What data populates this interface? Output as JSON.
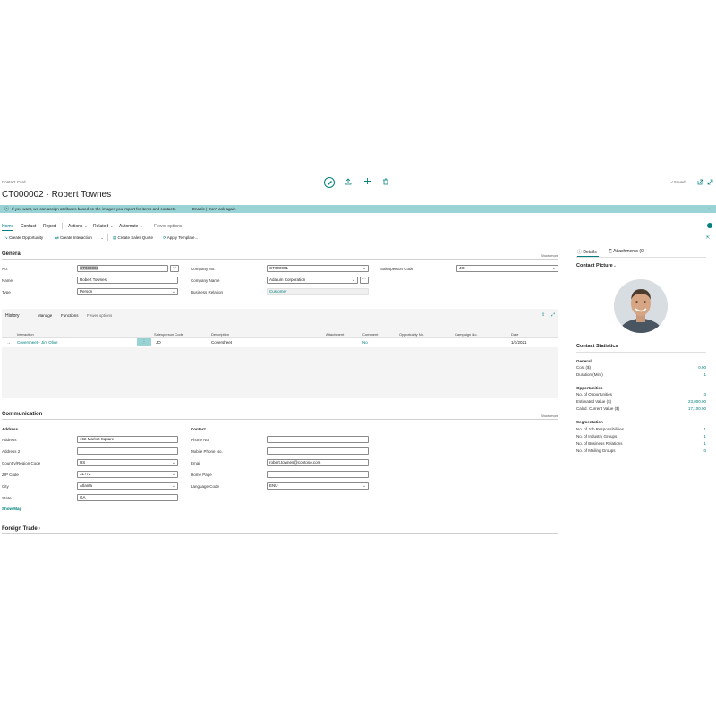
{
  "header": {
    "breadcrumb": "Contact Card",
    "title": "CT000002 · Robert Townes",
    "saved": "Saved"
  },
  "banner": {
    "text": "If you want, we can assign attributes based on the images you import for items and contacts.",
    "actions": "Enable | Don't ask again"
  },
  "menu": {
    "home": "Home",
    "contact": "Contact",
    "report": "Report",
    "actions": "Actions",
    "related": "Related",
    "automate": "Automate",
    "fewer": "Fewer options"
  },
  "actionbar": {
    "create_opportunity": "Create Opportunity",
    "create_interaction": "Create Interaction",
    "create_sales_quote": "Create Sales Quote",
    "apply_template": "Apply Template..."
  },
  "general": {
    "title": "General",
    "show_more": "Show more",
    "no_label": "No.",
    "no_value": "CT000002",
    "name_label": "Name",
    "name_value": "Robert Townes",
    "type_label": "Type",
    "type_value": "Person",
    "company_no_label": "Company No.",
    "company_no_value": "CT000001",
    "company_name_label": "Company Name",
    "company_name_value": "Adatum Corporation",
    "business_relation_label": "Business Relation",
    "business_relation_value": "Customer",
    "salesperson_label": "Salesperson Code",
    "salesperson_value": "JO"
  },
  "history": {
    "tabs": [
      "History",
      "Manage",
      "Functions",
      "Fewer options"
    ],
    "columns": [
      "Interaction",
      "Salesperson Code",
      "Description",
      "Attachment",
      "Comment",
      "Opportunity No.",
      "Campaign No.",
      "Date"
    ],
    "row": {
      "interaction": "Coversheet - Jim Olive",
      "salesperson": "JO",
      "description": "Coversheet",
      "comment": "No",
      "date": "1/1/2021"
    }
  },
  "communication": {
    "title": "Communication",
    "show_more": "Show more",
    "address_header": "Address",
    "contact_header": "Contact",
    "address_label": "Address",
    "address_value": "192 Market Square",
    "address2_label": "Address 2",
    "address2_value": "",
    "country_label": "Country/Region Code",
    "country_value": "US",
    "zip_label": "ZIP Code",
    "zip_value": "31772",
    "city_label": "City",
    "city_value": "Atlanta",
    "state_label": "State",
    "state_value": "GA",
    "show_map": "Show Map",
    "phone_label": "Phone No.",
    "phone_value": "",
    "mobile_label": "Mobile Phone No.",
    "mobile_value": "",
    "email_label": "Email",
    "email_value": "robert.townes@contoso.com",
    "homepage_label": "Home Page",
    "homepage_value": "",
    "language_label": "Language Code",
    "language_value": "ENU"
  },
  "foreign_trade": {
    "title": "Foreign Trade"
  },
  "factbox": {
    "tab_details": "Details",
    "tab_attachments": "Attachments (0)",
    "picture_title": "Contact Picture",
    "stats_title": "Contact Statistics",
    "groups": [
      {
        "title": "General",
        "rows": [
          {
            "label": "Cost ($)",
            "value": "0.00"
          },
          {
            "label": "Duration (Min.)",
            "value": "1"
          }
        ]
      },
      {
        "title": "Opportunities",
        "rows": [
          {
            "label": "No. of Opportunities",
            "value": "3"
          },
          {
            "label": "Estimated Value ($)",
            "value": "23,000.00"
          },
          {
            "label": "Calcd. Current Value ($)",
            "value": "17,100.00"
          }
        ]
      },
      {
        "title": "Segmentation",
        "rows": [
          {
            "label": "No. of Job Responsibilities",
            "value": "1"
          },
          {
            "label": "No. of Industry Groups",
            "value": "1"
          },
          {
            "label": "No. of Business Relations",
            "value": "1"
          },
          {
            "label": "No. of Mailing Groups",
            "value": "0"
          }
        ]
      }
    ]
  },
  "colors": {
    "accent": "#00807e",
    "banner_bg": "#9ad3d6",
    "selected_field": "#c7c7c7"
  }
}
